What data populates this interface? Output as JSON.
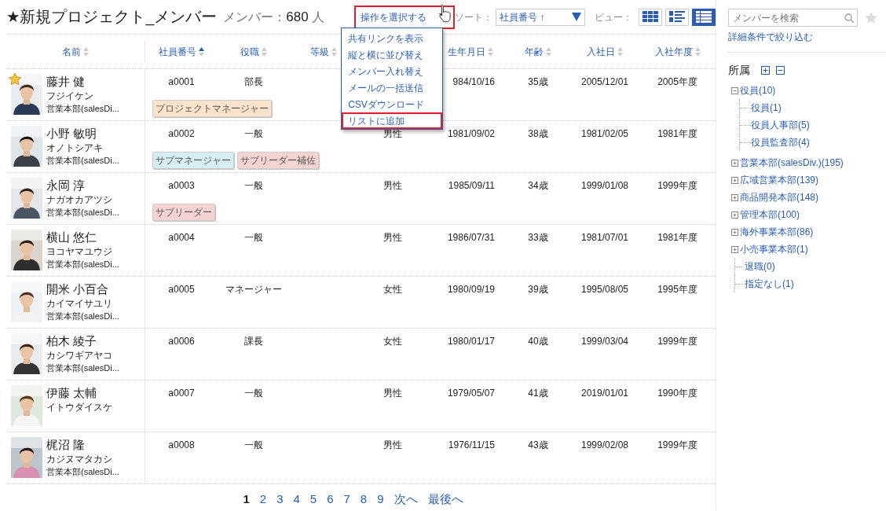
{
  "title": "★新規プロジェクト_メンバー",
  "member_count": {
    "label": "メンバー：",
    "count": "680",
    "unit": "人"
  },
  "action_menu": {
    "label": "操作を選択する",
    "highlighted": true,
    "expanded": true,
    "items": [
      {
        "label": "共有リンクを表示",
        "highlighted": false
      },
      {
        "label": "縦と横に並び替え",
        "highlighted": false
      },
      {
        "label": "メンバー入れ替え",
        "highlighted": false
      },
      {
        "label": "メールの一括送信",
        "highlighted": false
      },
      {
        "label": "CSVダウンロード",
        "highlighted": false
      },
      {
        "label": "リストに追加",
        "highlighted": true
      }
    ]
  },
  "sort": {
    "label": "ソート：",
    "value": "社員番号 ↑"
  },
  "view": {
    "label": "ビュー：",
    "modes": [
      {
        "kind": "grid",
        "selected": false
      },
      {
        "kind": "list",
        "selected": false
      },
      {
        "kind": "table",
        "selected": true
      }
    ]
  },
  "table": {
    "columns": [
      {
        "label": "名前",
        "sorted_ascending": false
      },
      {
        "label": "社員番号",
        "sorted_ascending": true
      },
      {
        "label": "役職",
        "sorted_ascending": false
      },
      {
        "label": "等級",
        "sorted_ascending": false
      },
      {},
      {
        "label": "生年月日",
        "sorted_ascending": false
      },
      {
        "label": "年齢",
        "sorted_ascending": false
      },
      {
        "label": "入社日",
        "sorted_ascending": false
      },
      {
        "label": "入社年度",
        "sorted_ascending": false
      }
    ],
    "rows": [
      {
        "name": "藤井 健",
        "kana": "フジイケン",
        "dept": "営業本部(salesDi...",
        "starred": true,
        "employee_no": "a0001",
        "position": "部長",
        "birth_date": "984/10/16",
        "age": "35歳",
        "hire_date": "2005/12/01",
        "hire_year": "2005年度",
        "tags": [
          {
            "label": "プロジェクトマネージャー",
            "color": "#fbe3cb"
          }
        ]
      },
      {
        "name": "小野 敏明",
        "kana": "オノトシアキ",
        "dept": "営業本部(salesDi...",
        "starred": false,
        "employee_no": "a0002",
        "position": "一般",
        "gender": "男性",
        "birth_date": "1981/09/02",
        "age": "38歳",
        "hire_date": "1981/02/05",
        "hire_year": "1981年度",
        "tags": [
          {
            "label": "サブマネージャー",
            "color": "#d6eef3"
          },
          {
            "label": "サブリーダー補佐",
            "color": "#f6d3d3"
          }
        ]
      },
      {
        "name": "永岡 淳",
        "kana": "ナガオカアツシ",
        "dept": "営業本部(salesDi...",
        "starred": false,
        "employee_no": "a0003",
        "position": "一般",
        "gender": "男性",
        "birth_date": "1985/09/11",
        "age": "34歳",
        "hire_date": "1999/01/08",
        "hire_year": "1999年度",
        "tags": [
          {
            "label": "サブリーダー",
            "color": "#f6d3d3"
          }
        ]
      },
      {
        "name": "横山 悠仁",
        "kana": "ヨコヤマユウジ",
        "dept": "営業本部(salesDi...",
        "starred": false,
        "employee_no": "a0004",
        "position": "一般",
        "gender": "男性",
        "birth_date": "1986/07/31",
        "age": "33歳",
        "hire_date": "1981/07/01",
        "hire_year": "1981年度"
      },
      {
        "name": "開米 小百合",
        "kana": "カイマイサユリ",
        "dept": "営業本部(salesDi...",
        "starred": false,
        "employee_no": "a0005",
        "position": "マネージャー",
        "gender": "女性",
        "birth_date": "1980/09/19",
        "age": "39歳",
        "hire_date": "1995/08/05",
        "hire_year": "1995年度"
      },
      {
        "name": "柏木 綾子",
        "kana": "カシワギアヤコ",
        "dept": "営業本部(salesDi...",
        "starred": false,
        "employee_no": "a0006",
        "position": "課長",
        "gender": "女性",
        "birth_date": "1980/01/17",
        "age": "40歳",
        "hire_date": "1999/03/04",
        "hire_year": "1999年度"
      },
      {
        "name": "伊藤 太輔",
        "kana": "イトウダイスケ",
        "starred": false,
        "employee_no": "a0007",
        "position": "一般",
        "gender": "男性",
        "birth_date": "1979/05/07",
        "age": "41歳",
        "hire_date": "2019/01/01",
        "hire_year": "1990年度"
      },
      {
        "name": "梶沼 隆",
        "kana": "カジヌマタカシ",
        "dept": "営業本部(salesDi...",
        "starred": false,
        "employee_no": "a0008",
        "position": "一般",
        "gender": "男性",
        "birth_date": "1976/11/15",
        "age": "43歳",
        "hire_date": "1999/02/08",
        "hire_year": "1999年度"
      }
    ]
  },
  "pagination": {
    "pages": [
      {
        "label": "1",
        "selected": true
      },
      {
        "label": "2",
        "selected": false
      },
      {
        "label": "3",
        "selected": false
      },
      {
        "label": "4",
        "selected": false
      },
      {
        "label": "5",
        "selected": false
      },
      {
        "label": "6",
        "selected": false
      },
      {
        "label": "7",
        "selected": false
      },
      {
        "label": "8",
        "selected": false
      },
      {
        "label": "9",
        "selected": false
      }
    ],
    "next": "次へ",
    "last": "最後へ"
  },
  "sidebar": {
    "search": {
      "placeholder": "メンバーを検索"
    },
    "filter_link": "詳細条件で絞り込む",
    "tree_title": "所属",
    "tree": [
      {
        "label": "役員(10)",
        "expanded": true,
        "children": [
          {
            "label": "役員(1)"
          },
          {
            "label": "役員人事部(5)"
          },
          {
            "label": "役員監査部(4)"
          }
        ]
      },
      {
        "label": "営業本部(salesDiv.)(195)",
        "expanded": false
      },
      {
        "label": "広域営業本部(139)",
        "expanded": false
      },
      {
        "label": "商品開発本部(148)",
        "expanded": false
      },
      {
        "label": "管理本部(100)",
        "expanded": false
      },
      {
        "label": "海外事業本部(86)",
        "expanded": false
      },
      {
        "label": "小売事業本部(1)",
        "expanded": false
      },
      {
        "label": "退職(0)"
      },
      {
        "label": "指定なし(1)"
      }
    ]
  }
}
